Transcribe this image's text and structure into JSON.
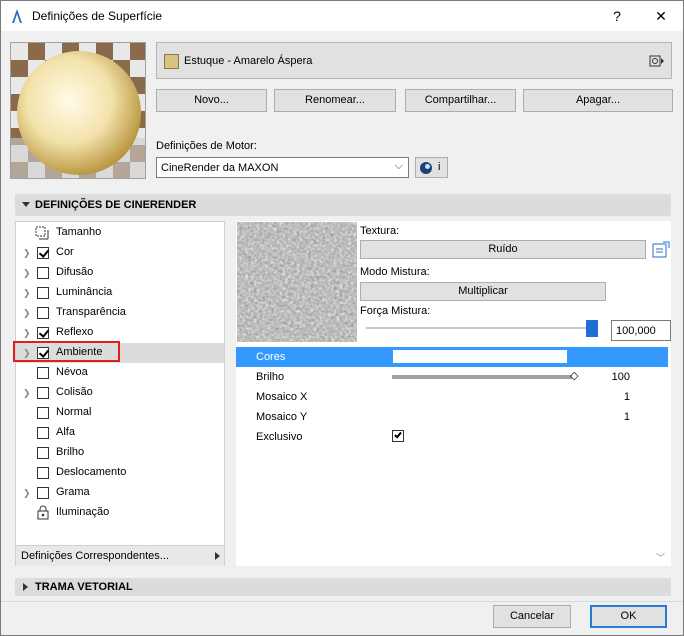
{
  "window": {
    "title": "Definições de Superfície",
    "help": "?",
    "close": "✕"
  },
  "material": {
    "name": "Estuque - Amarelo Áspera",
    "swatch_color": "#d8c383"
  },
  "actions": {
    "new": "Novo...",
    "rename": "Renomear...",
    "share": "Compartilhar...",
    "delete": "Apagar..."
  },
  "engine": {
    "label": "Definições de Motor:",
    "value": "CineRender da MAXON",
    "info": "i"
  },
  "sections": {
    "cinerender": "DEFINIÇÕES DE CINERENDER",
    "vector": "TRAMA VETORIAL"
  },
  "channels": [
    {
      "label": "Tamanho",
      "checked": false,
      "expandable": false
    },
    {
      "label": "Cor",
      "checked": true,
      "expandable": true
    },
    {
      "label": "Difusão",
      "checked": false,
      "expandable": true
    },
    {
      "label": "Luminância",
      "checked": false,
      "expandable": true
    },
    {
      "label": "Transparência",
      "checked": false,
      "expandable": true
    },
    {
      "label": "Reflexo",
      "checked": true,
      "expandable": true
    },
    {
      "label": "Ambiente",
      "checked": true,
      "expandable": true
    },
    {
      "label": "Névoa",
      "checked": false,
      "expandable": false
    },
    {
      "label": "Colisão",
      "checked": false,
      "expandable": true
    },
    {
      "label": "Normal",
      "checked": false,
      "expandable": false
    },
    {
      "label": "Alfa",
      "checked": false,
      "expandable": false
    },
    {
      "label": "Brilho",
      "checked": false,
      "expandable": false
    },
    {
      "label": "Deslocamento",
      "checked": false,
      "expandable": false
    },
    {
      "label": "Grama",
      "checked": false,
      "expandable": true
    },
    {
      "label": "Iluminação",
      "checked": false,
      "expandable": false
    }
  ],
  "corresp": "Definições Correspondentes...",
  "texture": {
    "label": "Textura:",
    "value": "Ruído"
  },
  "blend_mode": {
    "label": "Modo Mistura:",
    "value": "Multiplicar"
  },
  "blend_strength": {
    "label": "Força Mistura:",
    "value": "100,000",
    "level": 1.0
  },
  "properties": {
    "colors": "Cores",
    "brightness": "Brilho",
    "brightness_value": "100",
    "tile_x": "Mosaico X",
    "tile_x_value": "1",
    "tile_y": "Mosaico Y",
    "tile_y_value": "1",
    "exclusive": "Exclusivo"
  },
  "footer": {
    "cancel": "Cancelar",
    "ok": "OK"
  },
  "accent": "#3399ff"
}
